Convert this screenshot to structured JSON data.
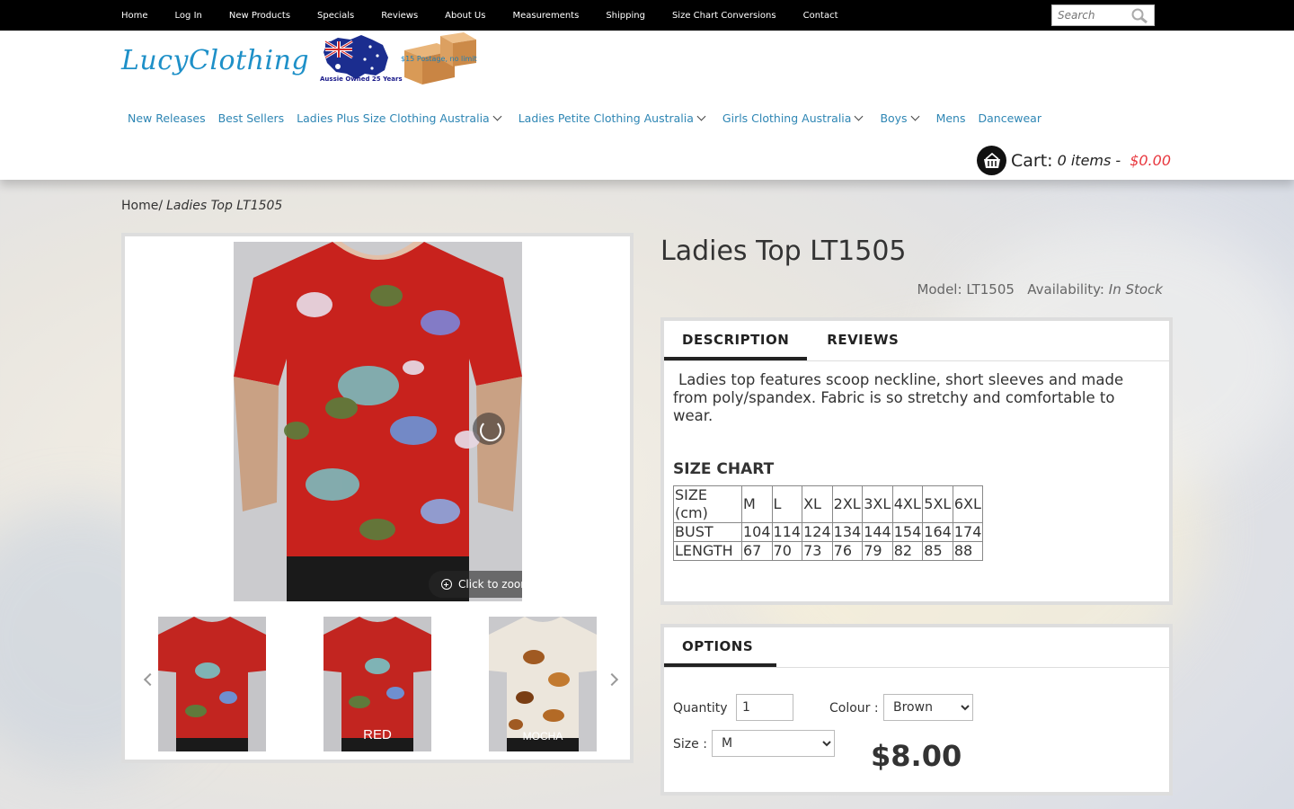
{
  "topnav": {
    "links": [
      "Home",
      "Log In",
      "New Products",
      "Specials",
      "Reviews",
      "About Us",
      "Measurements",
      "Shipping",
      "Size Chart Conversions",
      "Contact"
    ],
    "search_placeholder": "Search"
  },
  "header": {
    "logo": "LucyClothing",
    "flag_caption": "Aussie Owned 25 Years",
    "postage_caption": "$15 Postage, no limit",
    "nav": [
      {
        "label": "New Releases",
        "dropdown": false
      },
      {
        "label": "Best Sellers",
        "dropdown": false
      },
      {
        "label": "Ladies Plus Size Clothing Australia",
        "dropdown": true
      },
      {
        "label": "Ladies Petite Clothing Australia",
        "dropdown": true
      },
      {
        "label": "Girls Clothing Australia",
        "dropdown": true
      },
      {
        "label": "Boys",
        "dropdown": true
      },
      {
        "label": "Mens",
        "dropdown": false
      },
      {
        "label": "Dancewear",
        "dropdown": false
      }
    ],
    "cart": {
      "label": "Cart:",
      "items": "0 items -",
      "total": "$0.00"
    }
  },
  "breadcrumb": {
    "home": "Home",
    "separator": "/",
    "current": "Ladies Top LT1505"
  },
  "gallery": {
    "zoom_label": "Click to zoom",
    "thumbs": [
      {
        "label": ""
      },
      {
        "label": "RED"
      },
      {
        "label": "MOCHA"
      }
    ]
  },
  "product": {
    "title": "Ladies Top LT1505",
    "model_label": "Model:",
    "model": "LT1505",
    "availability_label": "Availability:",
    "availability": "In Stock",
    "tabs": [
      "DESCRIPTION",
      "REVIEWS"
    ],
    "description": "Ladies top features scoop neckline, short sleeves and made from poly/spandex. Fabric is so stretchy and comfortable to wear.",
    "size_chart_title": "SIZE CHART",
    "size_chart": [
      [
        "SIZE (cm)",
        "M",
        "L",
        "XL",
        "2XL",
        "3XL",
        "4XL",
        "5XL",
        "6XL"
      ],
      [
        "BUST",
        "104",
        "114",
        "124",
        "134",
        "144",
        "154",
        "164",
        "174"
      ],
      [
        "LENGTH",
        "67",
        "70",
        "73",
        "76",
        "79",
        "82",
        "85",
        "88"
      ]
    ]
  },
  "options": {
    "tab": "OPTIONS",
    "quantity_label": "Quantity",
    "quantity": "1",
    "colour_label": "Colour :",
    "colour": "Brown",
    "size_label": "Size :",
    "size": "M",
    "price": "$8.00"
  },
  "colors": {
    "accent_link": "#2e86b4",
    "cart_total": "#e8373e",
    "topbar": "#000000"
  }
}
